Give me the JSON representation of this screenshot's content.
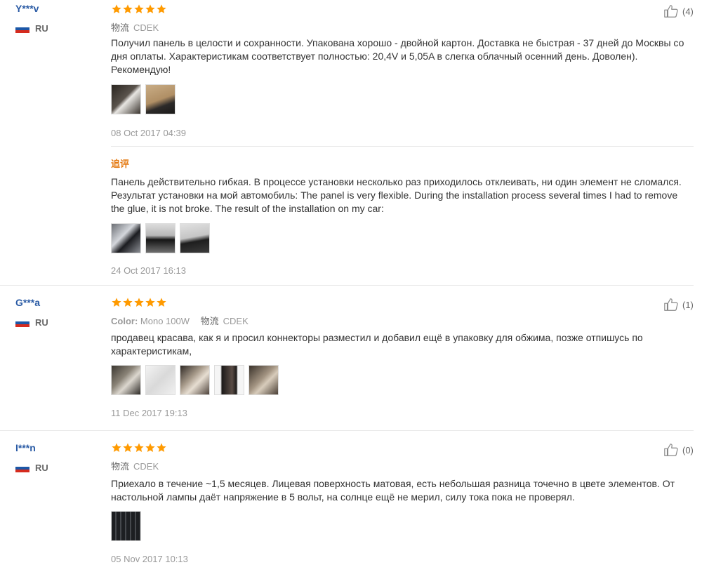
{
  "reviews": [
    {
      "user": "Y***v",
      "country": "RU",
      "rating": 5,
      "logistics_label": "物流",
      "logistics_value": "CDEK",
      "text": "Получил панель в целости и сохранности. Упакована хорошо - двойной картон. Доставка не быстрая - 37 дней до Москвы со дня оплаты. Характеристикам соответствует полностью: 20,4V и 5,05A в слегка облачный осенний день. Доволен). Рекомендую!",
      "date": "08 Oct 2017 04:39",
      "likes": "(4)",
      "followup_label": "追评",
      "followup_text": "Панель действительно гибкая. В процессе установки несколько раз приходилось отклеивать, ни один элемент не сломался. Результат установки на мой автомобиль: The panel is very flexible. During the installation process several times I had to remove the glue, it is not broke. The result of the installation on my car:",
      "followup_date": "24 Oct 2017 16:13"
    },
    {
      "user": "G***a",
      "country": "RU",
      "rating": 5,
      "color_label": "Color:",
      "color_value": "Mono 100W",
      "logistics_label": "物流",
      "logistics_value": "CDEK",
      "text": "продавец красава, как я и просил коннекторы разместил и добавил ещё в упаковку для обжима, позже отпишусь по характеристикам,",
      "date": "11 Dec 2017 19:13",
      "likes": "(1)"
    },
    {
      "user": "I***n",
      "country": "RU",
      "rating": 5,
      "logistics_label": "物流",
      "logistics_value": "CDEK",
      "text": "Приехало в течение ~1,5 месяцев. Лицевая поверхность матовая, есть небольшая разница точечно в цвете элементов. От настольной лампы даёт напряжение в 5 вольт, на солнце ещё не мерил, силу тока пока не проверял.",
      "date": "05 Nov 2017 10:13",
      "likes": "(0)"
    }
  ],
  "colors": {
    "star": "#ff9a00",
    "username": "#2a5ba5",
    "followup": "#e47911"
  }
}
